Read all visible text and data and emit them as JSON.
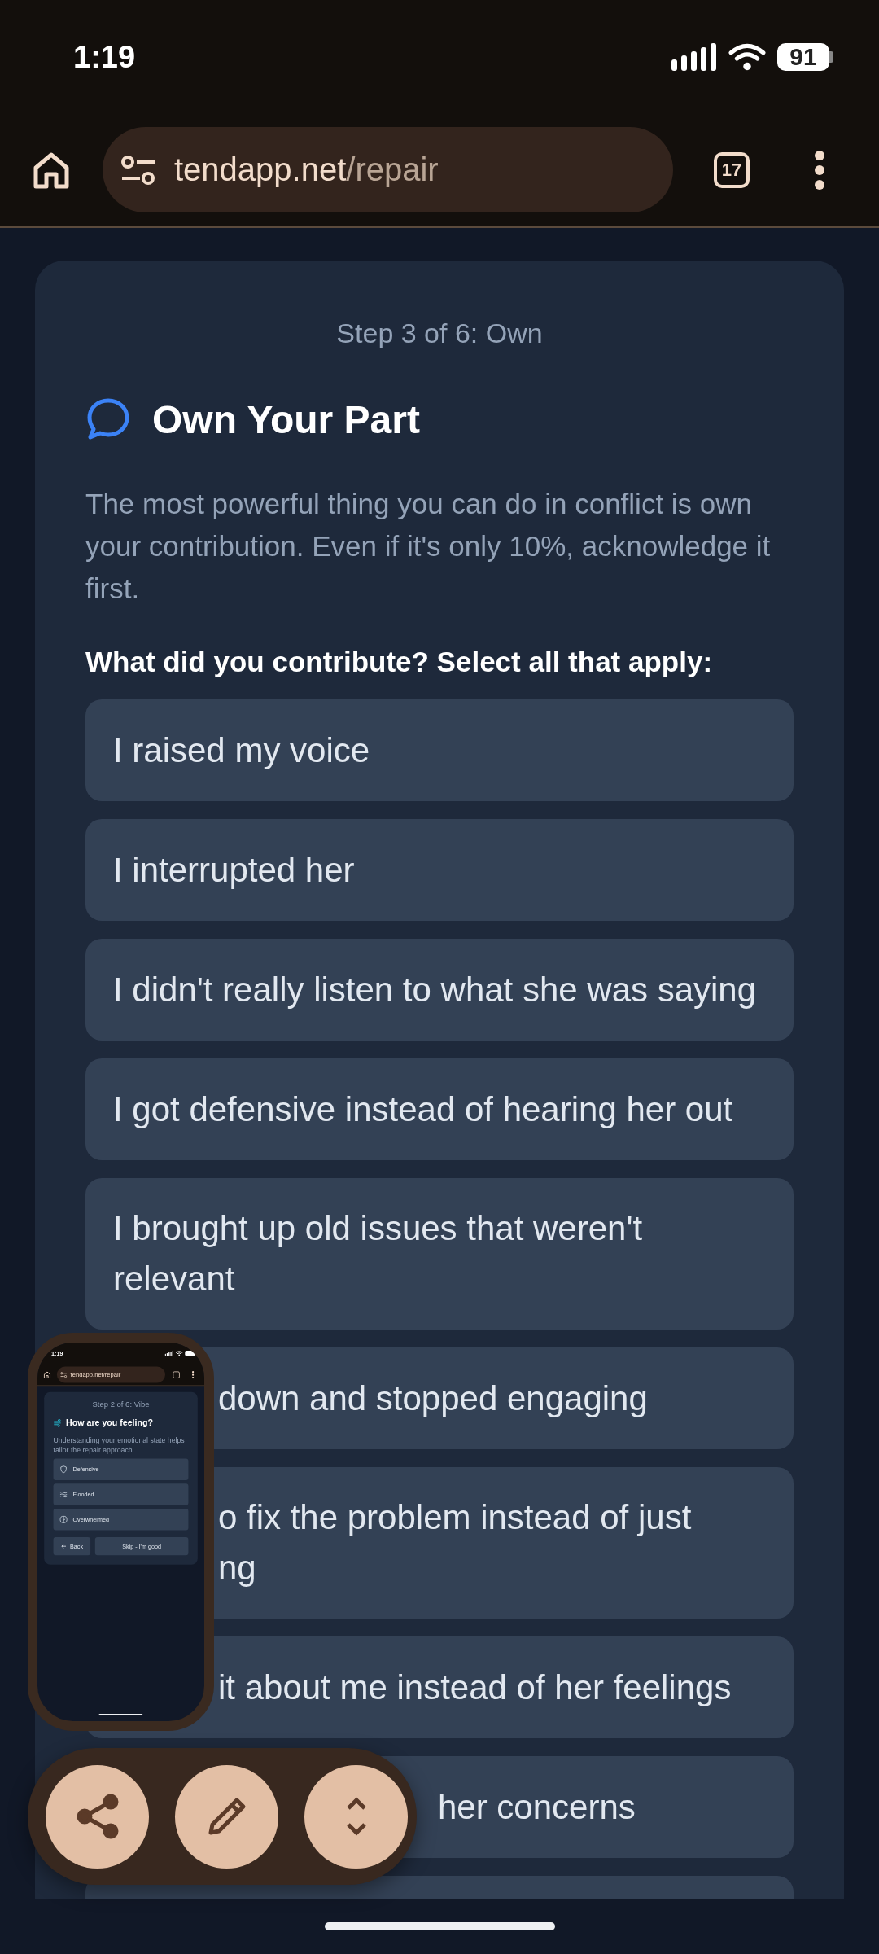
{
  "status_bar": {
    "time": "1:19",
    "battery": "91"
  },
  "browser": {
    "url_host": "tendapp.net",
    "url_path": "/repair",
    "tab_count": "17"
  },
  "step": "Step 3 of 6: Own",
  "title": "Own Your Part",
  "description": "The most powerful thing you can do in conflict is own your contribution. Even if it's only 10%, acknowledge it first.",
  "question": "What did you contribute? Select all that apply:",
  "options": [
    {
      "label": "I raised my voice",
      "selected": false
    },
    {
      "label": "I interrupted her",
      "selected": false
    },
    {
      "label": "I didn't really listen to what she was saying",
      "selected": false
    },
    {
      "label": "I got defensive instead of hearing her out",
      "selected": false
    },
    {
      "label": "I brought up old issues that weren't relevant",
      "selected": false
    },
    {
      "label": "down and stopped engaging",
      "selected": false,
      "kind": "clipped"
    },
    {
      "label": "o fix the problem instead of just\nng",
      "selected": false,
      "kind": "clipped"
    },
    {
      "label": "it about me instead of her feelings",
      "selected": false,
      "kind": "clipped"
    },
    {
      "label": "her concerns",
      "selected": false,
      "kind": "cut"
    }
  ],
  "preview": {
    "time": "1:19",
    "url": "tendapp.net/repair",
    "step": "Step 2 of 6: Vibe",
    "title": "How are you feeling?",
    "description": "Understanding your emotional state helps tailor the repair approach.",
    "options": [
      {
        "label": "Defensive",
        "kind": "shield"
      },
      {
        "label": "Flooded",
        "kind": "waves"
      },
      {
        "label": "Overwhelmed",
        "kind": "brain"
      }
    ],
    "back": "Back",
    "skip": "Skip - I'm good"
  },
  "controls": [
    {
      "kind": "share"
    },
    {
      "kind": "edit"
    },
    {
      "kind": "expand"
    }
  ]
}
